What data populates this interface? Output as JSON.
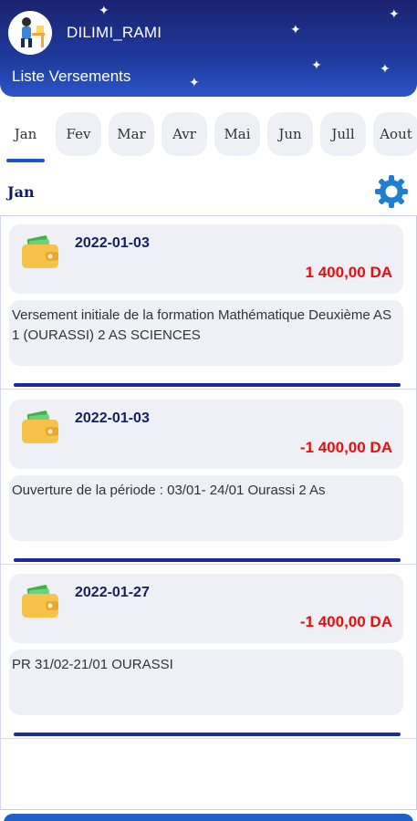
{
  "header": {
    "user_name": "DILIMI_RAMI",
    "page_title": "Liste Versements"
  },
  "months": [
    "Jan",
    "Fev",
    "Mar",
    "Avr",
    "Mai",
    "Jun",
    "Jull",
    "Aout"
  ],
  "selected_month_index": 0,
  "section": {
    "title": "Jan"
  },
  "entries": [
    {
      "date": "2022-01-03",
      "amount": "1 400,00 DA",
      "description": "Versement initiale de la formation Mathématique Deuxième AS 1 (OURASSI) 2 AS SCIENCES"
    },
    {
      "date": "2022-01-03",
      "amount": "-1 400,00 DA",
      "description": "Ouverture de la période : 03/01- 24/01 Ourassi 2 As"
    },
    {
      "date": "2022-01-27",
      "amount": "-1 400,00 DA",
      "description": "PR 31/02-21/01 OURASSI"
    }
  ],
  "colors": {
    "header_bg": "#1f3a9c",
    "amount": "#e31010",
    "accent": "#1f56c6",
    "divider": "#1b2a9e"
  },
  "icons": {
    "avatar": "person-at-desk-icon",
    "settings": "gear-icon",
    "entry": "wallet-icon"
  }
}
